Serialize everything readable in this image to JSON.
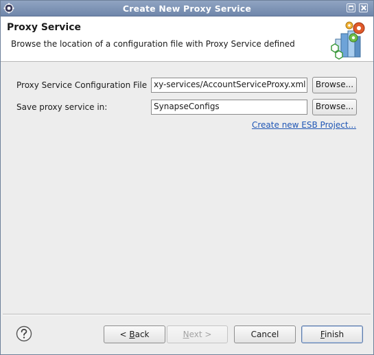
{
  "window": {
    "title": "Create New Proxy Service"
  },
  "header": {
    "title": "Proxy Service",
    "description": "Browse the location of a configuration file with Proxy Service defined"
  },
  "form": {
    "config_file_label": "Proxy Service Configuration File",
    "config_file_value": "xy-services/AccountServiceProxy.xml",
    "config_browse_label": "Browse...",
    "save_in_label": "Save proxy service in:",
    "save_in_value": "SynapseConfigs",
    "save_browse_label": "Browse...",
    "create_project_link": "Create new ESB Project..."
  },
  "footer": {
    "back_label_pre": "< ",
    "back_label_mnemonic": "B",
    "back_label_post": "ack",
    "next_label_mnemonic": "N",
    "next_label_post": "ext >",
    "cancel_label": "Cancel",
    "finish_label_mnemonic": "F",
    "finish_label_post": "inish"
  },
  "colors": {
    "titlebar": "#7f95b8",
    "link": "#1f56b5",
    "header_bg": "#ffffff",
    "dialog_bg": "#ededed"
  },
  "icons": {
    "app": "eclipse-gear-icon",
    "wizard": "proxy-service-wizard-icon",
    "help": "help-icon"
  }
}
